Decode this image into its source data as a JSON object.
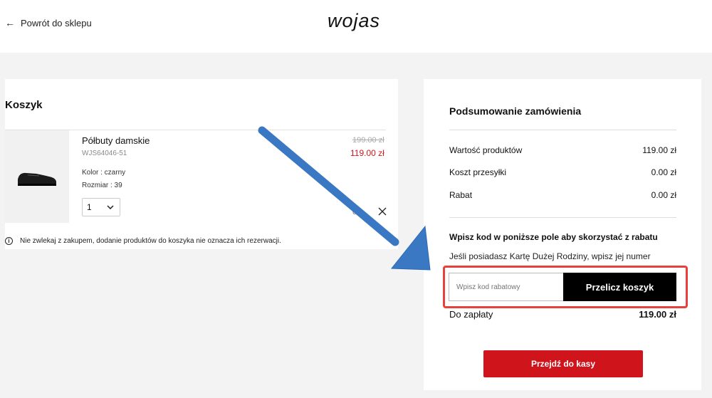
{
  "header": {
    "back_label": "Powrót do sklepu",
    "logo_text": "wojas"
  },
  "cart": {
    "title": "Koszyk",
    "product": {
      "name": "Półbuty damskie",
      "sku": "WJS64046-51",
      "color": "Kolor : czarny",
      "size": "Rozmiar : 39",
      "quantity": "1",
      "price_old": "199.00 zł",
      "price_new": "119.00 zł",
      "price_partial": "0"
    },
    "notice": "Nie zwlekaj z zakupem, dodanie produktów do koszyka nie oznacza ich rezerwacji."
  },
  "summary": {
    "title": "Podsumowanie zamówienia",
    "rows": [
      {
        "label": "Wartość produktów",
        "value": "119.00 zł"
      },
      {
        "label": "Koszt przesyłki",
        "value": "0.00 zł"
      },
      {
        "label": "Rabat",
        "value": "0.00 zł"
      }
    ],
    "promo_title": "Wpisz kod w poniższe pole aby skorzystać z rabatu",
    "promo_sub": "Jeśli posiadasz Kartę Dużej Rodziny, wpisz jej numer",
    "coupon_placeholder": "Wpisz kod rabatowy",
    "coupon_button": "Przelicz koszyk",
    "total_label": "Do zapłaty",
    "total_value": "119.00 zł",
    "checkout_button": "Przejdź do kasy"
  },
  "colors": {
    "accent_red": "#d0141c",
    "annotation_blue": "#3a78c4",
    "annotation_red": "#e8403a"
  }
}
